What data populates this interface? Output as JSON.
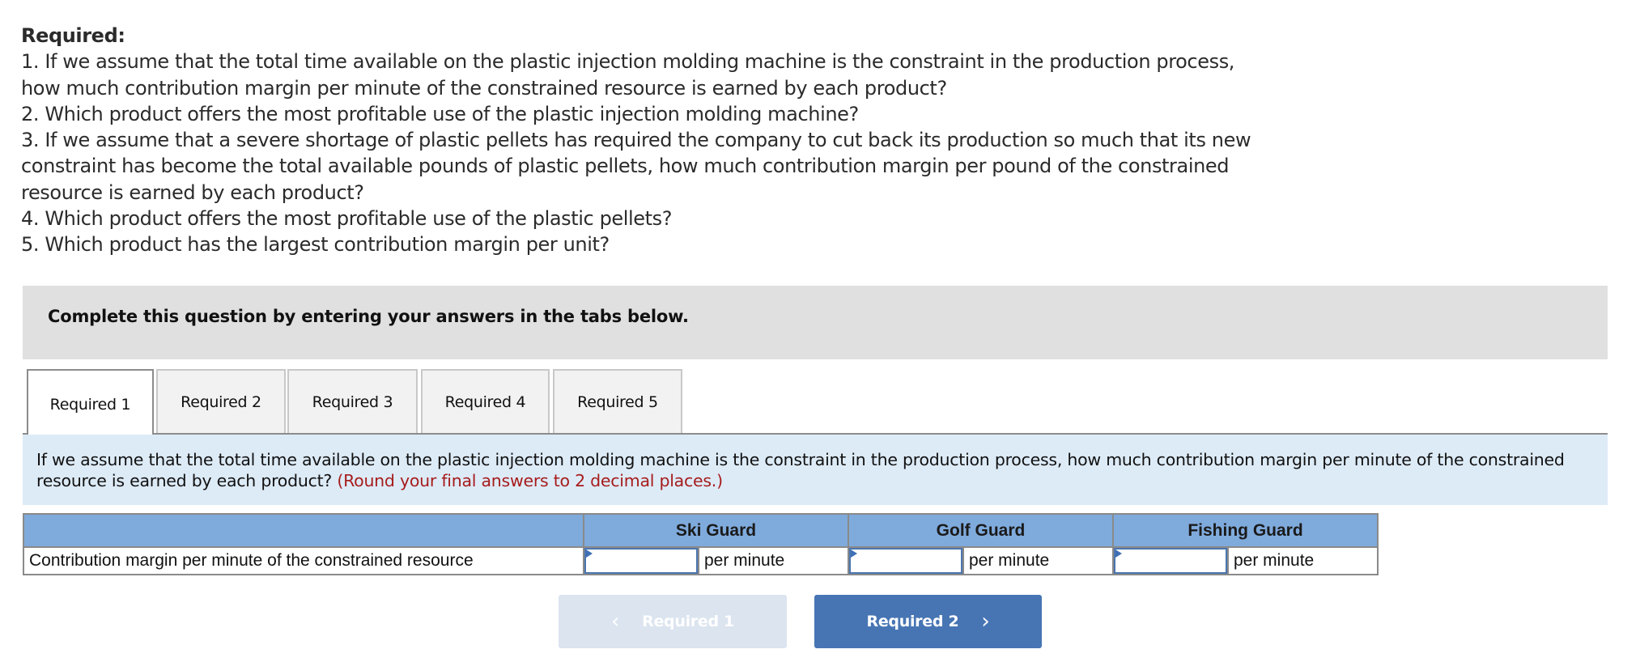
{
  "required": {
    "heading": "Required:",
    "lines": [
      "1. If we assume that the total time available on the plastic injection molding machine is the constraint in the production process,",
      "how much contribution margin per minute of the constrained resource is earned by each product?",
      "2. Which product offers the most profitable use of the plastic injection molding machine?",
      "3. If we assume that a severe shortage of plastic pellets has required the company to cut back its production so much that its new",
      "constraint has become the total available pounds of plastic pellets, how much contribution margin per pound of the constrained",
      "resource is earned by each product?",
      "4. Which product offers the most profitable use of the plastic pellets?",
      "5. Which product has the largest contribution margin per unit?"
    ]
  },
  "instruction": "Complete this question by entering your answers in the tabs below.",
  "tabs": [
    {
      "label": "Required 1",
      "active": true
    },
    {
      "label": "Required 2",
      "active": false
    },
    {
      "label": "Required 3",
      "active": false
    },
    {
      "label": "Required 4",
      "active": false
    },
    {
      "label": "Required 5",
      "active": false
    }
  ],
  "question": {
    "text": "If we assume that the total time available on the plastic injection molding machine is the constraint in the production process, how much contribution margin per minute of the constrained resource is earned by each product?",
    "hint": "(Round your final answers to 2 decimal places.)"
  },
  "table": {
    "header_blank": "",
    "columns": [
      "Ski Guard",
      "Golf Guard",
      "Fishing Guard"
    ],
    "rows": [
      {
        "label": "Contribution margin per minute of the constrained resource",
        "cells": [
          {
            "value": "",
            "unit": "per minute"
          },
          {
            "value": "",
            "unit": "per minute"
          },
          {
            "value": "",
            "unit": "per minute"
          }
        ]
      }
    ]
  },
  "navigation": {
    "prev_label": "Required 1",
    "prev_icon": "chevron-left-icon",
    "prev_glyph": "‹",
    "next_label": "Required 2",
    "next_icon": "chevron-right-icon",
    "next_glyph": "›",
    "prev_enabled": false
  },
  "colors": {
    "instruction_bg": "#e0e0e0",
    "question_bg": "#ddebf7",
    "hint_text": "#a61c1c",
    "table_header_bg": "#7faadc",
    "input_border": "#4b76b0",
    "next_button_bg": "#4775b4",
    "prev_button_bg_disabled": "#dbe4ef"
  }
}
